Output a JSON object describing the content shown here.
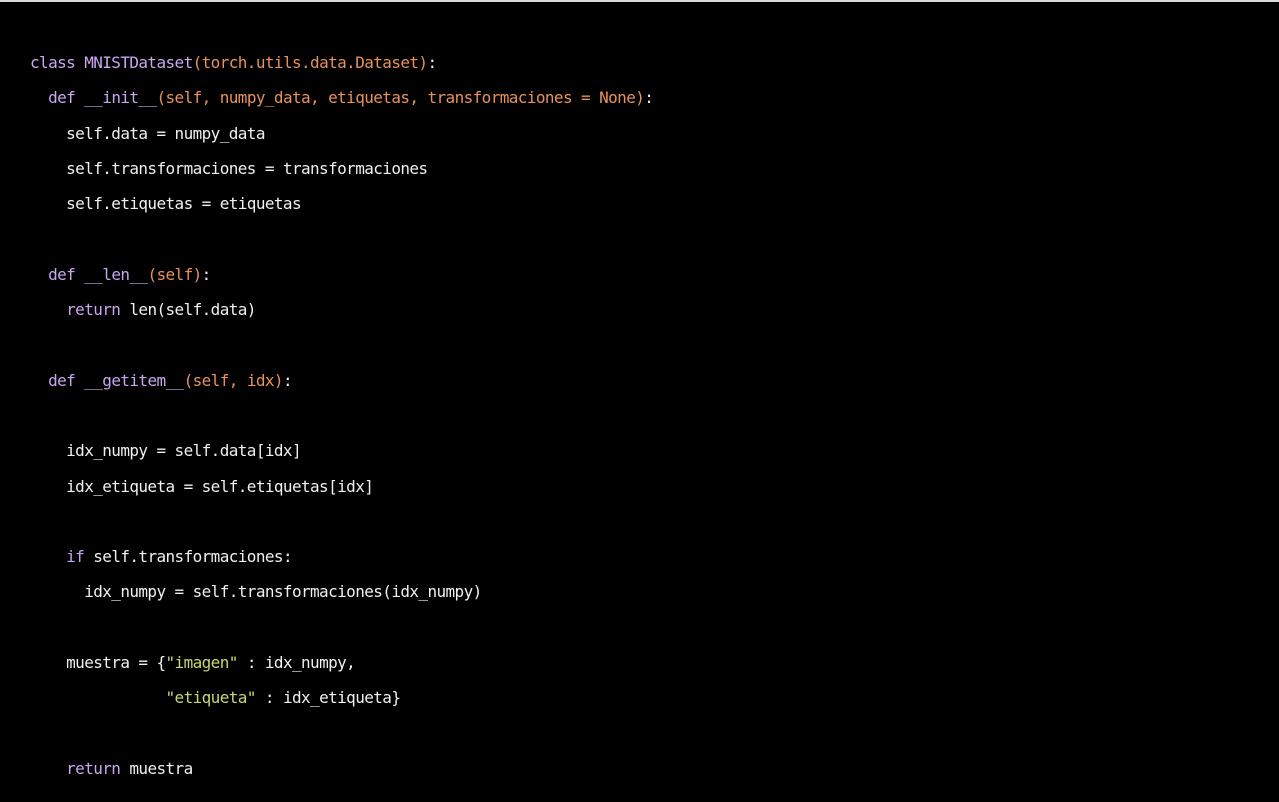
{
  "colors": {
    "background": "#000000",
    "default": "#f0f0f0",
    "keyword": "#c8a6f0",
    "signature": "#e8925a",
    "string": "#c9d872"
  },
  "lines": [
    {
      "indent": "",
      "tokens": [
        {
          "t": "class ",
          "c": "kw"
        },
        {
          "t": "MNISTDataset",
          "c": "cls"
        },
        {
          "t": "(torch.utils.data.Dataset)",
          "c": "sig"
        },
        {
          "t": ":",
          "c": "id"
        }
      ]
    },
    {
      "indent": "  ",
      "tokens": [
        {
          "t": "def ",
          "c": "kw"
        },
        {
          "t": "__init__",
          "c": "fn"
        },
        {
          "t": "(self, numpy_data, etiquetas, transformaciones = None)",
          "c": "sig"
        },
        {
          "t": ":",
          "c": "id"
        }
      ]
    },
    {
      "indent": "    ",
      "tokens": [
        {
          "t": "self.data = numpy_data",
          "c": "id"
        }
      ]
    },
    {
      "indent": "    ",
      "tokens": [
        {
          "t": "self.transformaciones = transformaciones",
          "c": "id"
        }
      ]
    },
    {
      "indent": "    ",
      "tokens": [
        {
          "t": "self.etiquetas = etiquetas",
          "c": "id"
        }
      ]
    },
    {
      "indent": "",
      "tokens": []
    },
    {
      "indent": "  ",
      "tokens": [
        {
          "t": "def ",
          "c": "kw"
        },
        {
          "t": "__len__",
          "c": "fn"
        },
        {
          "t": "(self)",
          "c": "sig"
        },
        {
          "t": ":",
          "c": "id"
        }
      ]
    },
    {
      "indent": "    ",
      "tokens": [
        {
          "t": "return ",
          "c": "kw"
        },
        {
          "t": "len(self.data)",
          "c": "id"
        }
      ]
    },
    {
      "indent": "",
      "tokens": []
    },
    {
      "indent": "  ",
      "tokens": [
        {
          "t": "def ",
          "c": "kw"
        },
        {
          "t": "__getitem__",
          "c": "fn"
        },
        {
          "t": "(self, idx)",
          "c": "sig"
        },
        {
          "t": ":",
          "c": "id"
        }
      ]
    },
    {
      "indent": "",
      "tokens": []
    },
    {
      "indent": "    ",
      "tokens": [
        {
          "t": "idx_numpy = self.data[idx]",
          "c": "id"
        }
      ]
    },
    {
      "indent": "    ",
      "tokens": [
        {
          "t": "idx_etiqueta = self.etiquetas[idx]",
          "c": "id"
        }
      ]
    },
    {
      "indent": "",
      "tokens": []
    },
    {
      "indent": "    ",
      "tokens": [
        {
          "t": "if ",
          "c": "kw"
        },
        {
          "t": "self.transformaciones:",
          "c": "id"
        }
      ]
    },
    {
      "indent": "      ",
      "tokens": [
        {
          "t": "idx_numpy = self.transformaciones(idx_numpy)",
          "c": "id"
        }
      ]
    },
    {
      "indent": "",
      "tokens": []
    },
    {
      "indent": "    ",
      "tokens": [
        {
          "t": "muestra = {",
          "c": "id"
        },
        {
          "t": "\"imagen\"",
          "c": "str"
        },
        {
          "t": " : idx_numpy,",
          "c": "id"
        }
      ]
    },
    {
      "indent": "               ",
      "tokens": [
        {
          "t": "\"etiqueta\"",
          "c": "str"
        },
        {
          "t": " : idx_etiqueta}",
          "c": "id"
        }
      ]
    },
    {
      "indent": "",
      "tokens": []
    },
    {
      "indent": "    ",
      "tokens": [
        {
          "t": "return ",
          "c": "kw"
        },
        {
          "t": "muestra",
          "c": "id"
        }
      ]
    }
  ]
}
